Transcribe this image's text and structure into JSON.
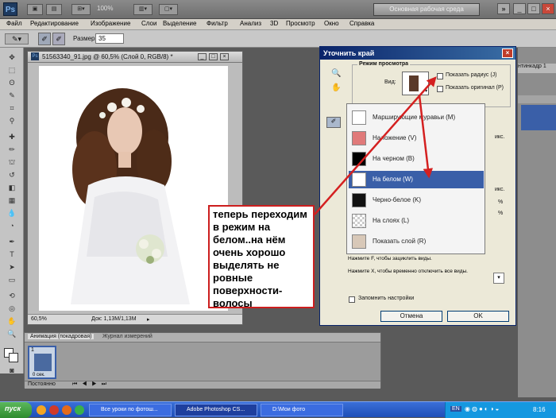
{
  "app": {
    "logo": "Ps",
    "zoom": "100%",
    "workspace": "Основная рабочая среда"
  },
  "menu": [
    "Файл",
    "Редактирование",
    "Изображение",
    "Слои",
    "Выделение",
    "Фильтр",
    "Анализ",
    "3D",
    "Просмотр",
    "Окно",
    "Справка"
  ],
  "options": {
    "size_label": "Размер:",
    "size_value": "35"
  },
  "document": {
    "title": "51563340_91.jpg @ 60,5% (Слой 0, RGB/8) *",
    "zoom": "60,5%",
    "doc_info": "Док: 1,13M/1,13M"
  },
  "dialog": {
    "title": "Уточнить край",
    "view_mode_section": "Режим просмотра",
    "view_label": "Вид:",
    "show_radius": "Показать радиус (J)",
    "show_original": "Показать оригинал (P)",
    "remember": "Запомнить настройки",
    "cancel": "Отмена",
    "ok": "OK",
    "side_text": [
      "икс.",
      "икс.",
      "%",
      "%"
    ]
  },
  "dropdown": {
    "items": [
      {
        "label": "Марширующие муравьи (M)",
        "selected": false
      },
      {
        "label": "Наложение (V)",
        "selected": false
      },
      {
        "label": "На черном (B)",
        "selected": false
      },
      {
        "label": "На белом (W)",
        "selected": true
      },
      {
        "label": "Черно-белое (K)",
        "selected": false
      },
      {
        "label": "На слоях (L)",
        "selected": false
      },
      {
        "label": "Показать слой (R)",
        "selected": false
      }
    ],
    "hint1": "Нажмите F, чтобы зациклить виды.",
    "hint2": "Нажмите X, чтобы временно отключить все виды."
  },
  "annotation": "теперь переходим в режим на белом..на нём очень хорошо выделять не ровные поверхности-волосы",
  "animation": {
    "tab1": "Анимация (покадровая)",
    "tab2": "Журнал измерений",
    "frame_num": "1",
    "frame_time": "0 сек.",
    "loop": "Постоянно"
  },
  "right_panel": {
    "label": "нтинкадр 1"
  },
  "taskbar": {
    "start": "пуск",
    "tasks": [
      "Все уроки по фотош...",
      "Adobe Photoshop CS...",
      "D:\\Мои фото"
    ],
    "lang": "EN",
    "time": "8:16"
  },
  "colors": {
    "accent": "#3a5fa8",
    "annotation_border": "#cc1e1e",
    "arrow": "#d42020"
  }
}
